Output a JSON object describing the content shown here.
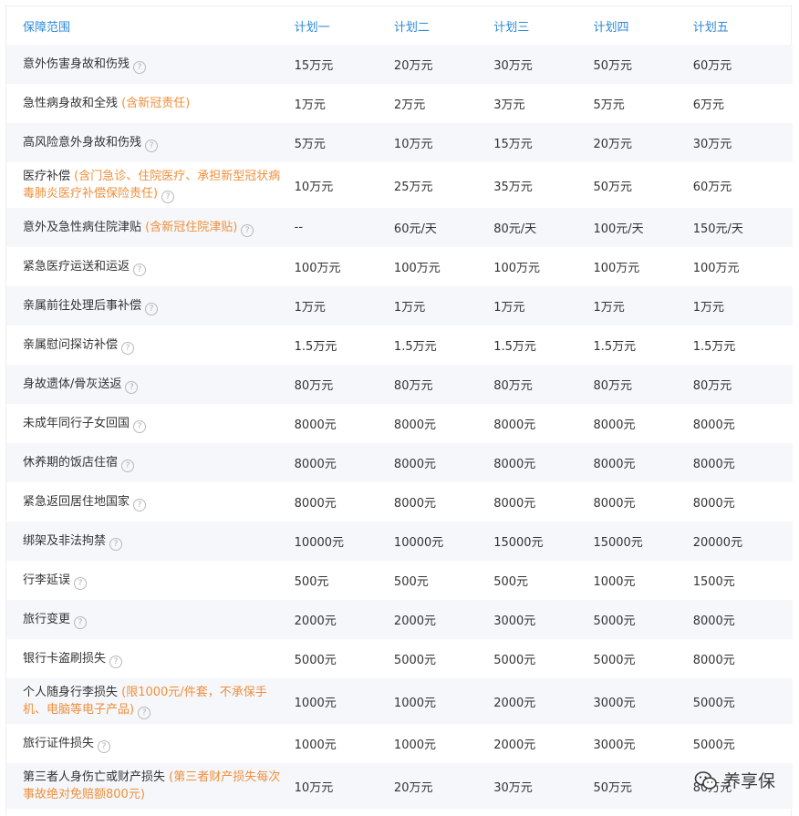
{
  "header": {
    "coverage": "保障范围",
    "plans": [
      "计划一",
      "计划二",
      "计划三",
      "计划四",
      "计划五"
    ]
  },
  "help_glyph": "?",
  "rows": [
    {
      "name": "意外伤害身故和伤残",
      "note": "",
      "help": true,
      "values": [
        "15万元",
        "20万元",
        "30万元",
        "50万元",
        "60万元"
      ]
    },
    {
      "name": "急性病身故和全残",
      "note": "(含新冠责任)",
      "help": false,
      "values": [
        "1万元",
        "2万元",
        "3万元",
        "5万元",
        "6万元"
      ]
    },
    {
      "name": "高风险意外身故和伤残",
      "note": "",
      "help": true,
      "values": [
        "5万元",
        "10万元",
        "15万元",
        "20万元",
        "30万元"
      ]
    },
    {
      "name": "医疗补偿",
      "note": "(含门急诊、住院医疗、承担新型冠状病毒肺炎医疗补偿保险责任)",
      "help": true,
      "tall": true,
      "values": [
        "10万元",
        "25万元",
        "35万元",
        "50万元",
        "60万元"
      ]
    },
    {
      "name": "意外及急性病住院津贴",
      "note": "(含新冠住院津贴)",
      "help": true,
      "values": [
        "--",
        "60元/天",
        "80元/天",
        "100元/天",
        "150元/天"
      ]
    },
    {
      "name": "紧急医疗运送和运返",
      "note": "",
      "help": true,
      "values": [
        "100万元",
        "100万元",
        "100万元",
        "100万元",
        "100万元"
      ]
    },
    {
      "name": "亲属前往处理后事补偿",
      "note": "",
      "help": true,
      "values": [
        "1万元",
        "1万元",
        "1万元",
        "1万元",
        "1万元"
      ]
    },
    {
      "name": "亲属慰问探访补偿",
      "note": "",
      "help": true,
      "values": [
        "1.5万元",
        "1.5万元",
        "1.5万元",
        "1.5万元",
        "1.5万元"
      ]
    },
    {
      "name": "身故遗体/骨灰送返",
      "note": "",
      "help": true,
      "values": [
        "80万元",
        "80万元",
        "80万元",
        "80万元",
        "80万元"
      ]
    },
    {
      "name": "未成年同行子女回国",
      "note": "",
      "help": true,
      "values": [
        "8000元",
        "8000元",
        "8000元",
        "8000元",
        "8000元"
      ]
    },
    {
      "name": "休养期的饭店住宿",
      "note": "",
      "help": true,
      "values": [
        "8000元",
        "8000元",
        "8000元",
        "8000元",
        "8000元"
      ]
    },
    {
      "name": "紧急返回居住地国家",
      "note": "",
      "help": true,
      "values": [
        "8000元",
        "8000元",
        "8000元",
        "8000元",
        "8000元"
      ]
    },
    {
      "name": "绑架及非法拘禁",
      "note": "",
      "help": true,
      "values": [
        "10000元",
        "10000元",
        "15000元",
        "15000元",
        "20000元"
      ]
    },
    {
      "name": "行李延误",
      "note": "",
      "help": true,
      "values": [
        "500元",
        "500元",
        "500元",
        "1000元",
        "1500元"
      ]
    },
    {
      "name": "旅行变更",
      "note": "",
      "help": true,
      "values": [
        "2000元",
        "2000元",
        "3000元",
        "5000元",
        "8000元"
      ]
    },
    {
      "name": "银行卡盗刷损失",
      "note": "",
      "help": true,
      "values": [
        "5000元",
        "5000元",
        "5000元",
        "5000元",
        "8000元"
      ]
    },
    {
      "name": "个人随身行李损失",
      "note": "(限1000元/件套，不承保手机、电脑等电子产品)",
      "help": true,
      "tall": true,
      "values": [
        "1000元",
        "1000元",
        "2000元",
        "3000元",
        "5000元"
      ]
    },
    {
      "name": "旅行证件损失",
      "note": "",
      "help": true,
      "values": [
        "1000元",
        "1000元",
        "2000元",
        "3000元",
        "5000元"
      ]
    },
    {
      "name": "第三者人身伤亡或财产损失",
      "note": "(第三者财产损失每次事故绝对免赔额800元)",
      "help": false,
      "tall": true,
      "values": [
        "10万元",
        "20万元",
        "30万元",
        "50万元",
        "80万元"
      ]
    }
  ],
  "watermark": {
    "text": "养享保",
    "icon": "wechat-logo-icon"
  }
}
